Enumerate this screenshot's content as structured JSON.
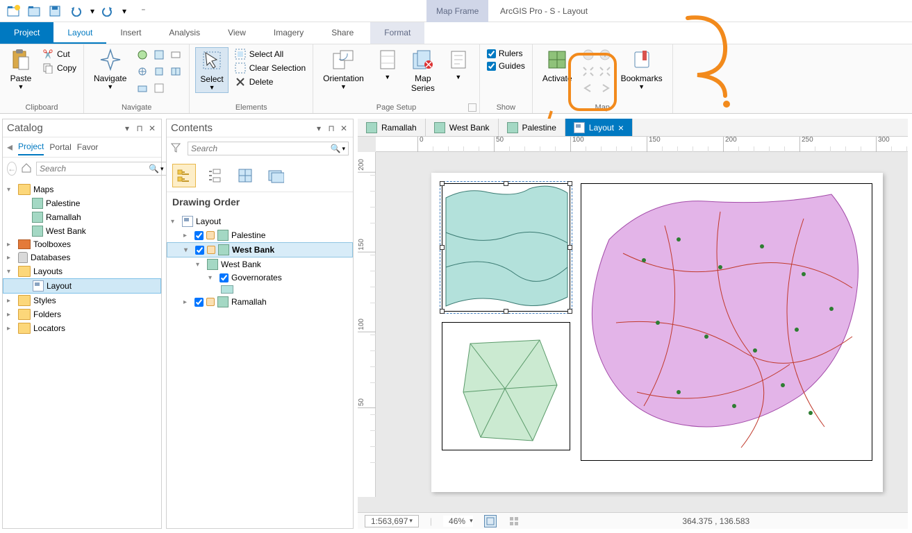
{
  "qat": {
    "context_tab": "Map Frame",
    "app_title": "ArcGIS Pro - S - Layout"
  },
  "tabs": {
    "file": "Project",
    "active": "Layout",
    "others": [
      "Insert",
      "Analysis",
      "View",
      "Imagery",
      "Share"
    ],
    "context": "Format"
  },
  "ribbon": {
    "clipboard": {
      "paste": "Paste",
      "cut": "Cut",
      "copy": "Copy",
      "label": "Clipboard"
    },
    "navigate": {
      "btn": "Navigate",
      "label": "Navigate"
    },
    "elements": {
      "select": "Select",
      "select_all": "Select All",
      "clear": "Clear Selection",
      "del": "Delete",
      "label": "Elements"
    },
    "page_setup": {
      "orientation": "Orientation",
      "map_series": "Map\nSeries",
      "label": "Page Setup"
    },
    "show": {
      "rulers": "Rulers",
      "guides": "Guides",
      "label": "Show"
    },
    "map": {
      "activate": "Activate",
      "bookmarks": "Bookmarks",
      "label": "Map"
    }
  },
  "catalog": {
    "title": "Catalog",
    "tabs": [
      "Project",
      "Portal",
      "Favor"
    ],
    "search_placeholder": "Search",
    "tree": {
      "maps": "Maps",
      "maps_children": [
        "Palestine",
        "Ramallah",
        "West Bank"
      ],
      "toolboxes": "Toolboxes",
      "databases": "Databases",
      "layouts": "Layouts",
      "layout_item": "Layout",
      "styles": "Styles",
      "folders": "Folders",
      "locators": "Locators"
    }
  },
  "contents": {
    "title": "Contents",
    "search_placeholder": "Search",
    "section": "Drawing Order",
    "root": "Layout",
    "frames": {
      "palestine": "Palestine",
      "westbank": "West Bank",
      "westbank_map": "West Bank",
      "gov": "Governorates",
      "ramallah": "Ramallah"
    }
  },
  "view_tabs": [
    "Ramallah",
    "West Bank",
    "Palestine",
    "Layout"
  ],
  "status": {
    "scale": "1:563,697",
    "zoom": "46%",
    "coords": "364.375 , 136.583"
  },
  "ruler_h": [
    "0",
    "50",
    "100",
    "150",
    "200",
    "250",
    "300"
  ],
  "ruler_v": [
    "200",
    "150",
    "100",
    "50"
  ]
}
